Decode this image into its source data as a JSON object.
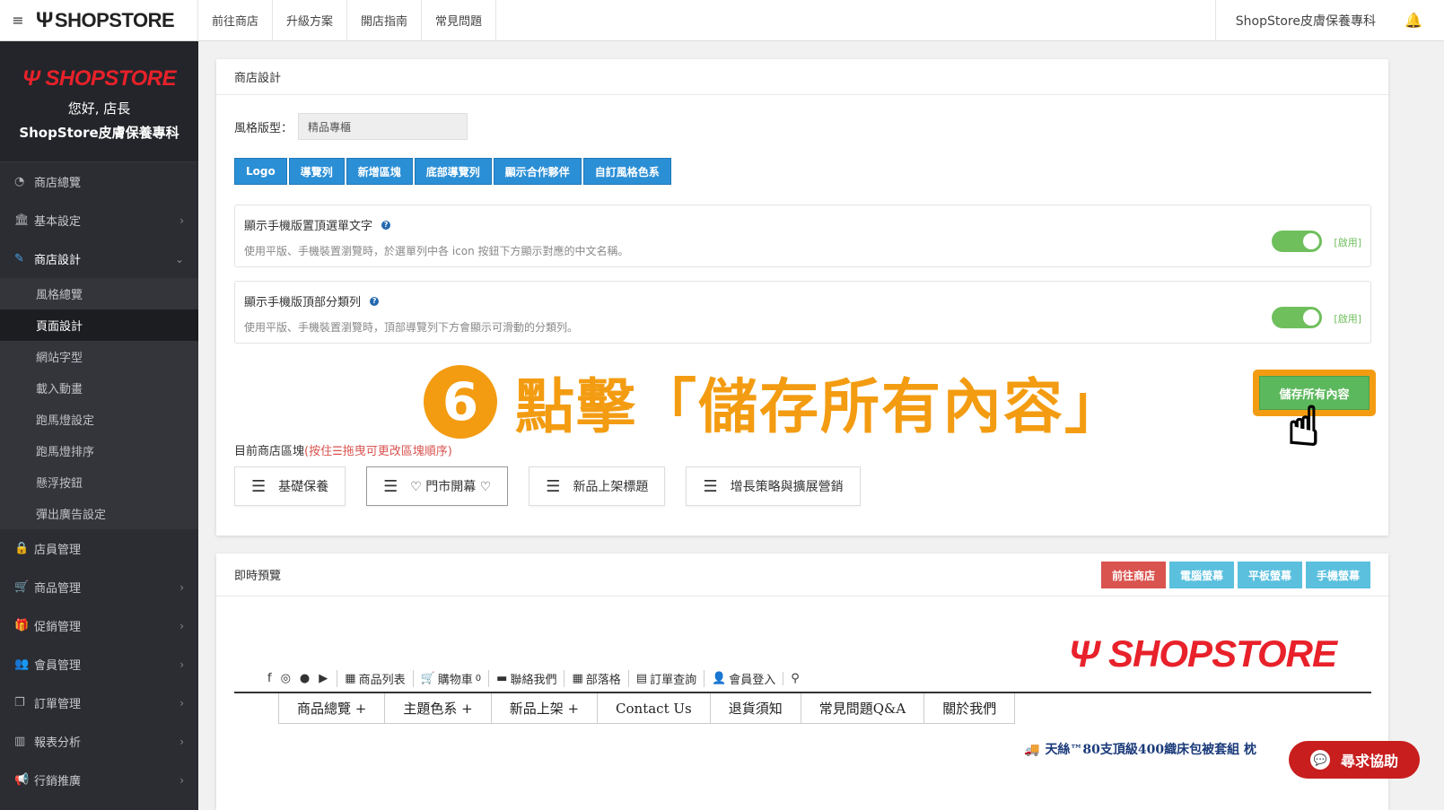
{
  "topbar": {
    "toggle_icon": "≡",
    "brand": "SHOPSTORE",
    "nav": [
      "前往商店",
      "升級方案",
      "開店指南",
      "常見問題"
    ],
    "store_name": "ShopStore皮膚保養專科"
  },
  "sidebar": {
    "logo": "SHOPSTORE",
    "greeting": "您好, 店長",
    "store_name": "ShopStore皮膚保養專科",
    "items": [
      {
        "label": "商店總覽",
        "icon": "dashboard-icon",
        "chevron": false
      },
      {
        "label": "基本設定",
        "icon": "bank-icon",
        "chevron": true
      },
      {
        "label": "商店設計",
        "icon": "wand-icon",
        "chevron": true,
        "open": true
      }
    ],
    "sub_items": [
      "風格總覽",
      "頁面設計",
      "網站字型",
      "載入動畫",
      "跑馬燈設定",
      "跑馬燈排序",
      "懸浮按鈕",
      "彈出廣告設定"
    ],
    "active_sub": "頁面設計",
    "items2": [
      {
        "label": "店員管理",
        "icon": "lock-icon",
        "chevron": false
      },
      {
        "label": "商品管理",
        "icon": "cart-icon",
        "chevron": true
      },
      {
        "label": "促銷管理",
        "icon": "gift-icon",
        "chevron": true
      },
      {
        "label": "會員管理",
        "icon": "users-icon",
        "chevron": true
      },
      {
        "label": "訂單管理",
        "icon": "copy-icon",
        "chevron": true
      },
      {
        "label": "報表分析",
        "icon": "bar-chart-icon",
        "chevron": true
      },
      {
        "label": "行銷推廣",
        "icon": "megaphone-icon",
        "chevron": true
      }
    ]
  },
  "design": {
    "title": "商店設計",
    "style_label": "風格版型：",
    "style_value": "精品專櫃",
    "tabs": [
      "Logo",
      "導覽列",
      "新增區塊",
      "底部導覽列",
      "顯示合作夥伴",
      "自訂風格色系"
    ],
    "settings": [
      {
        "title": "顯示手機版置頂選單文字",
        "desc": "使用平版、手機裝置瀏覽時，於選單列中各 icon 按鈕下方顯示對應的中文名稱。",
        "state": "[啟用]"
      },
      {
        "title": "顯示手機版頂部分類列",
        "desc": "使用平版、手機裝置瀏覽時，頂部導覽列下方會顯示可滑動的分類列。",
        "state": "[啟用]"
      }
    ],
    "overlay_num": "6",
    "overlay_text": "點擊「儲存所有內容」",
    "save_label": "儲存所有內容",
    "blocks_label": "目前商店區塊",
    "blocks_hint": "(按住☰拖曳可更改區塊順序)",
    "blocks": [
      "基礎保養",
      "♡ 門市開幕 ♡",
      "新品上架標題",
      "增長策略與擴展營銷"
    ]
  },
  "preview": {
    "title": "即時預覽",
    "buttons": [
      "前往商店",
      "電腦螢幕",
      "平板螢幕",
      "手機螢幕"
    ],
    "logo": "SHOPSTORE",
    "links": [
      "商品列表",
      "購物車",
      "聯絡我們",
      "部落格",
      "訂單查詢",
      "會員登入"
    ],
    "cart_count": "0",
    "menu": [
      "商品總覽 +",
      "主題色系 +",
      "新品上架 +",
      "Contact Us",
      "退貨須知",
      "常見問題Q&A",
      "關於我們"
    ],
    "marquee": "天絲™80支頂級400織床包被套組 枕"
  },
  "help_button": "尋求協助",
  "colors": {
    "sidebar_bg": "#2b2d33",
    "brand_red": "#e8212a",
    "primary_blue": "#2b8fd6",
    "accent_orange": "#f39c12",
    "success_green": "#5cb85c"
  }
}
